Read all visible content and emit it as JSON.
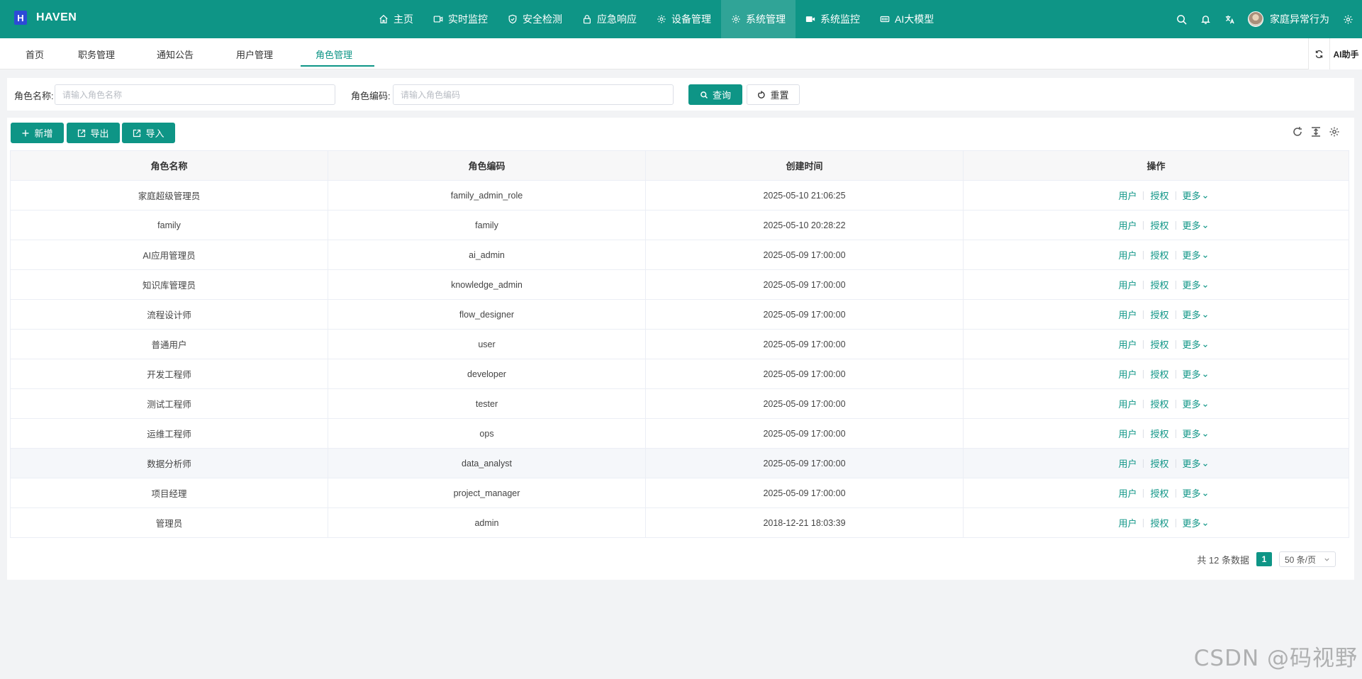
{
  "app": {
    "logo_letter": "H",
    "name": "HAVEN"
  },
  "nav": {
    "items": [
      {
        "label": "主页",
        "icon": "home-icon"
      },
      {
        "label": "实时监控",
        "icon": "video-icon"
      },
      {
        "label": "安全检测",
        "icon": "shield-icon"
      },
      {
        "label": "应急响应",
        "icon": "lock-icon"
      },
      {
        "label": "设备管理",
        "icon": "gear-icon"
      },
      {
        "label": "系统管理",
        "icon": "gear-icon",
        "active": true
      },
      {
        "label": "系统监控",
        "icon": "camera-icon"
      },
      {
        "label": "AI大模型",
        "icon": "ai-icon"
      }
    ]
  },
  "top_right": {
    "user_name": "家庭异常行为"
  },
  "tabs": {
    "items": [
      "首页",
      "职务管理",
      "通知公告",
      "用户管理",
      "角色管理"
    ],
    "active": "角色管理",
    "ai_label": "AI助手"
  },
  "search": {
    "role_name_label": "角色名称:",
    "role_name_placeholder": "请输入角色名称",
    "role_code_label": "角色编码:",
    "role_code_placeholder": "请输入角色编码",
    "query_label": "查询",
    "reset_label": "重置"
  },
  "toolbar": {
    "add_label": "新增",
    "export_label": "导出",
    "import_label": "导入"
  },
  "table": {
    "columns": [
      "角色名称",
      "角色编码",
      "创建时间",
      "操作"
    ],
    "rows": [
      {
        "name": "家庭超级管理员",
        "code": "family_admin_role",
        "time": "2025-05-10 21:06:25"
      },
      {
        "name": "family",
        "code": "family",
        "time": "2025-05-10 20:28:22"
      },
      {
        "name": "AI应用管理员",
        "code": "ai_admin",
        "time": "2025-05-09 17:00:00"
      },
      {
        "name": "知识库管理员",
        "code": "knowledge_admin",
        "time": "2025-05-09 17:00:00"
      },
      {
        "name": "流程设计师",
        "code": "flow_designer",
        "time": "2025-05-09 17:00:00"
      },
      {
        "name": "普通用户",
        "code": "user",
        "time": "2025-05-09 17:00:00"
      },
      {
        "name": "开发工程师",
        "code": "developer",
        "time": "2025-05-09 17:00:00"
      },
      {
        "name": "测试工程师",
        "code": "tester",
        "time": "2025-05-09 17:00:00"
      },
      {
        "name": "运维工程师",
        "code": "ops",
        "time": "2025-05-09 17:00:00"
      },
      {
        "name": "数据分析师",
        "code": "data_analyst",
        "time": "2025-05-09 17:00:00"
      },
      {
        "name": "项目经理",
        "code": "project_manager",
        "time": "2025-05-09 17:00:00"
      },
      {
        "name": "管理员",
        "code": "admin",
        "time": "2018-12-21 18:03:39"
      }
    ],
    "actions": {
      "user": "用户",
      "auth": "授权",
      "more": "更多"
    }
  },
  "pagination": {
    "total_text": "共 12 条数据",
    "current_page": "1",
    "page_size": "50 条/页"
  },
  "watermark": "CSDN @码视野",
  "colors": {
    "primary": "#0e9586",
    "logo": "#2d4bd6"
  }
}
